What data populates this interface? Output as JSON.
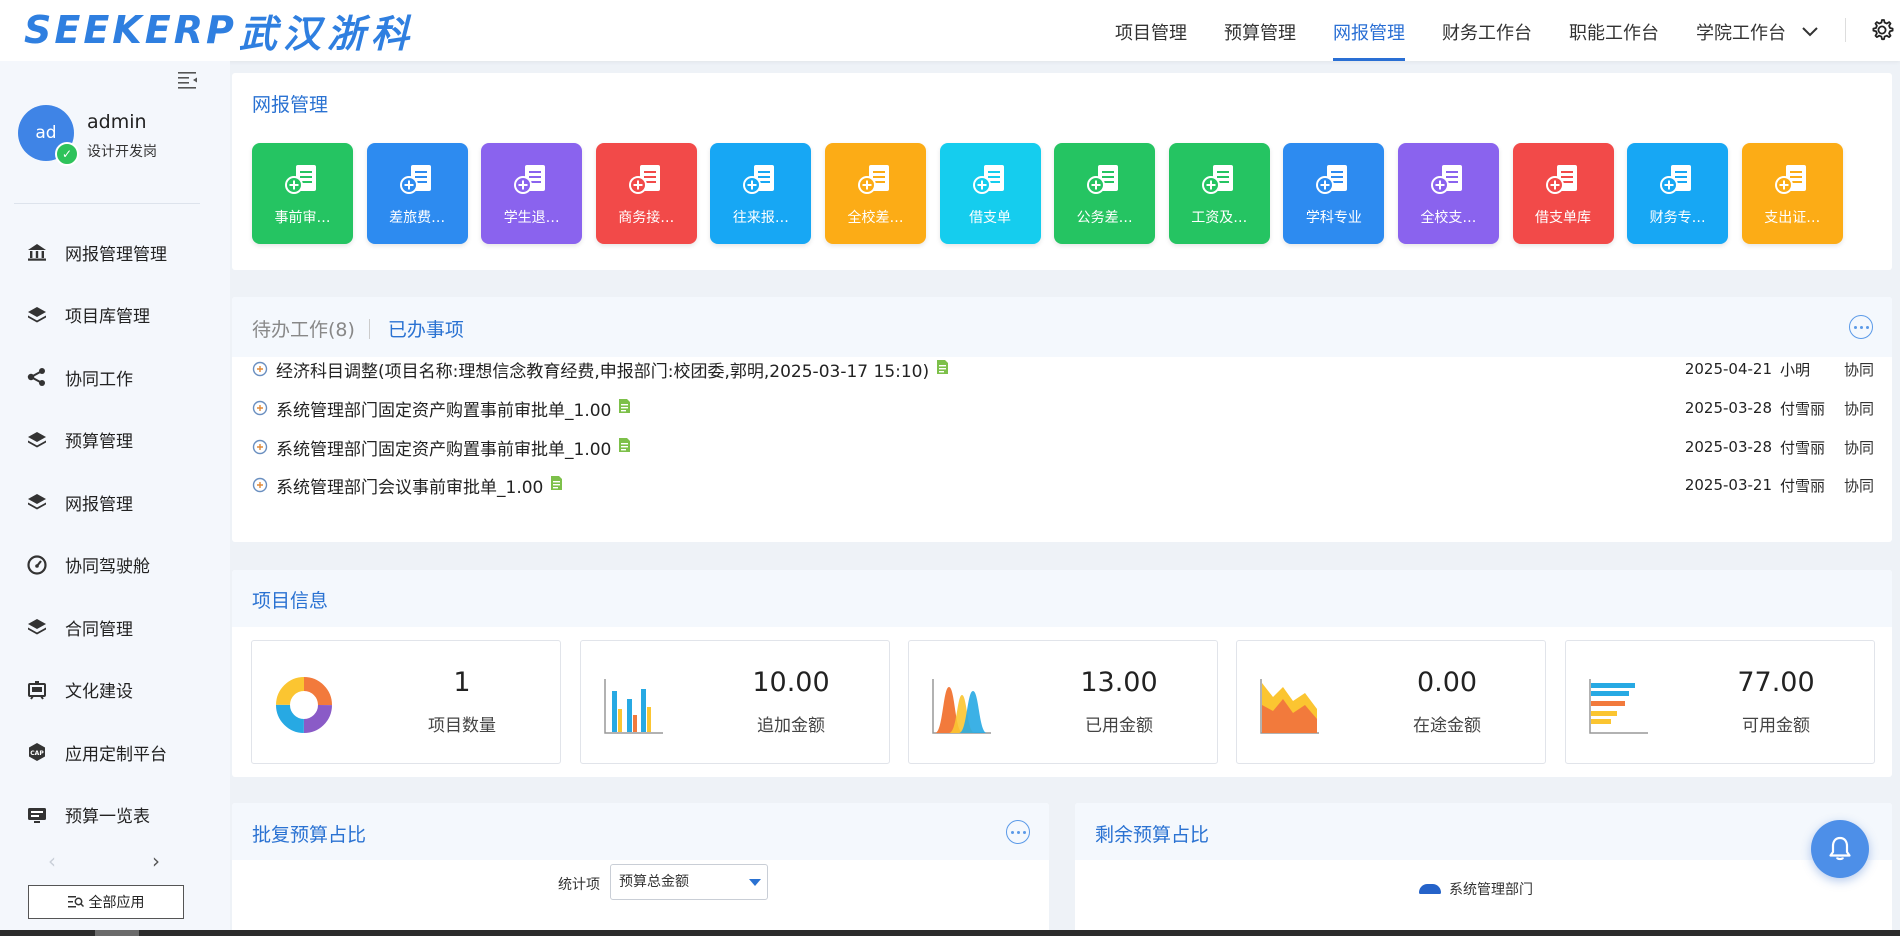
{
  "header": {
    "logo_text": "SEEKERP",
    "logo_cn": "武汉浙科",
    "nav": [
      "项目管理",
      "预算管理",
      "网报管理",
      "财务工作台",
      "职能工作台",
      "学院工作台"
    ],
    "active_nav": "网报管理",
    "more_symbol": "﹀"
  },
  "sidebar": {
    "user": {
      "avatar": "ad",
      "name": "admin",
      "role": "设计开发岗",
      "status_check": "✓"
    },
    "items": [
      {
        "label": "网报管理管理",
        "icon": "bank-icon"
      },
      {
        "label": "项目库管理",
        "icon": "layers-icon"
      },
      {
        "label": "协同工作",
        "icon": "share-icon"
      },
      {
        "label": "预算管理",
        "icon": "layers-icon"
      },
      {
        "label": "网报管理",
        "icon": "layers-icon"
      },
      {
        "label": "协同驾驶舱",
        "icon": "gauge-icon"
      },
      {
        "label": "合同管理",
        "icon": "layers-icon"
      },
      {
        "label": "文化建设",
        "icon": "easel-icon"
      },
      {
        "label": "应用定制平台",
        "icon": "cap-icon"
      },
      {
        "label": "预算一览表",
        "icon": "monitor-icon"
      }
    ],
    "pager_prev": "‹",
    "pager_next": "›",
    "all_apps_label": "全部应用"
  },
  "netreport_panel": {
    "title": "网报管理",
    "tiles": [
      {
        "label": "事前审…",
        "color": "#25c462"
      },
      {
        "label": "差旅费…",
        "color": "#2d8bf0"
      },
      {
        "label": "学生退…",
        "color": "#8a63ee"
      },
      {
        "label": "商务接…",
        "color": "#f24a49"
      },
      {
        "label": "往来报…",
        "color": "#17a7f4"
      },
      {
        "label": "全校差…",
        "color": "#fcac16"
      },
      {
        "label": "借支单",
        "color": "#15cdee"
      },
      {
        "label": "公务差…",
        "color": "#25c462"
      },
      {
        "label": "工资及…",
        "color": "#25c462"
      },
      {
        "label": "学科专业",
        "color": "#2d8bf0"
      },
      {
        "label": "全校支…",
        "color": "#8a63ee"
      },
      {
        "label": "借支单库",
        "color": "#f24a49"
      },
      {
        "label": "财务专…",
        "color": "#17a7f4"
      },
      {
        "label": "支出证…",
        "color": "#fcac16"
      }
    ]
  },
  "todo_panel": {
    "tab_todo": "待办工作(8)",
    "tab_done": "已办事项",
    "rows": [
      {
        "text": "经济科目调整(项目名称:理想信念教育经费,申报部门:校团委,郭明,2025-03-17 15:10)",
        "date": "2025-04-21",
        "who": "小明",
        "type": "协同"
      },
      {
        "text": "系统管理部门固定资产购置事前审批单_1.00",
        "date": "2025-03-28",
        "who": "付雪丽",
        "type": "协同"
      },
      {
        "text": "系统管理部门固定资产购置事前审批单_1.00",
        "date": "2025-03-28",
        "who": "付雪丽",
        "type": "协同"
      },
      {
        "text": "系统管理部门会议事前审批单_1.00",
        "date": "2025-03-21",
        "who": "付雪丽",
        "type": "协同"
      }
    ]
  },
  "project_panel": {
    "title": "项目信息",
    "stats": [
      {
        "value": "1",
        "label": "项目数量",
        "icon": "donut-chart-icon"
      },
      {
        "value": "10.00",
        "label": "追加金额",
        "icon": "bar-chart-icon"
      },
      {
        "value": "13.00",
        "label": "已用金额",
        "icon": "bell-curve-icon"
      },
      {
        "value": "0.00",
        "label": "在途金额",
        "icon": "area-chart-icon"
      },
      {
        "value": "77.00",
        "label": "可用金额",
        "icon": "hbar-chart-icon"
      }
    ]
  },
  "approved_panel": {
    "title": "批复预算占比",
    "select_label": "统计项",
    "select_value": "预算总金额"
  },
  "remaining_panel": {
    "title": "剩余预算占比",
    "legend": "系统管理部门",
    "legend_color": "#2563c9"
  }
}
